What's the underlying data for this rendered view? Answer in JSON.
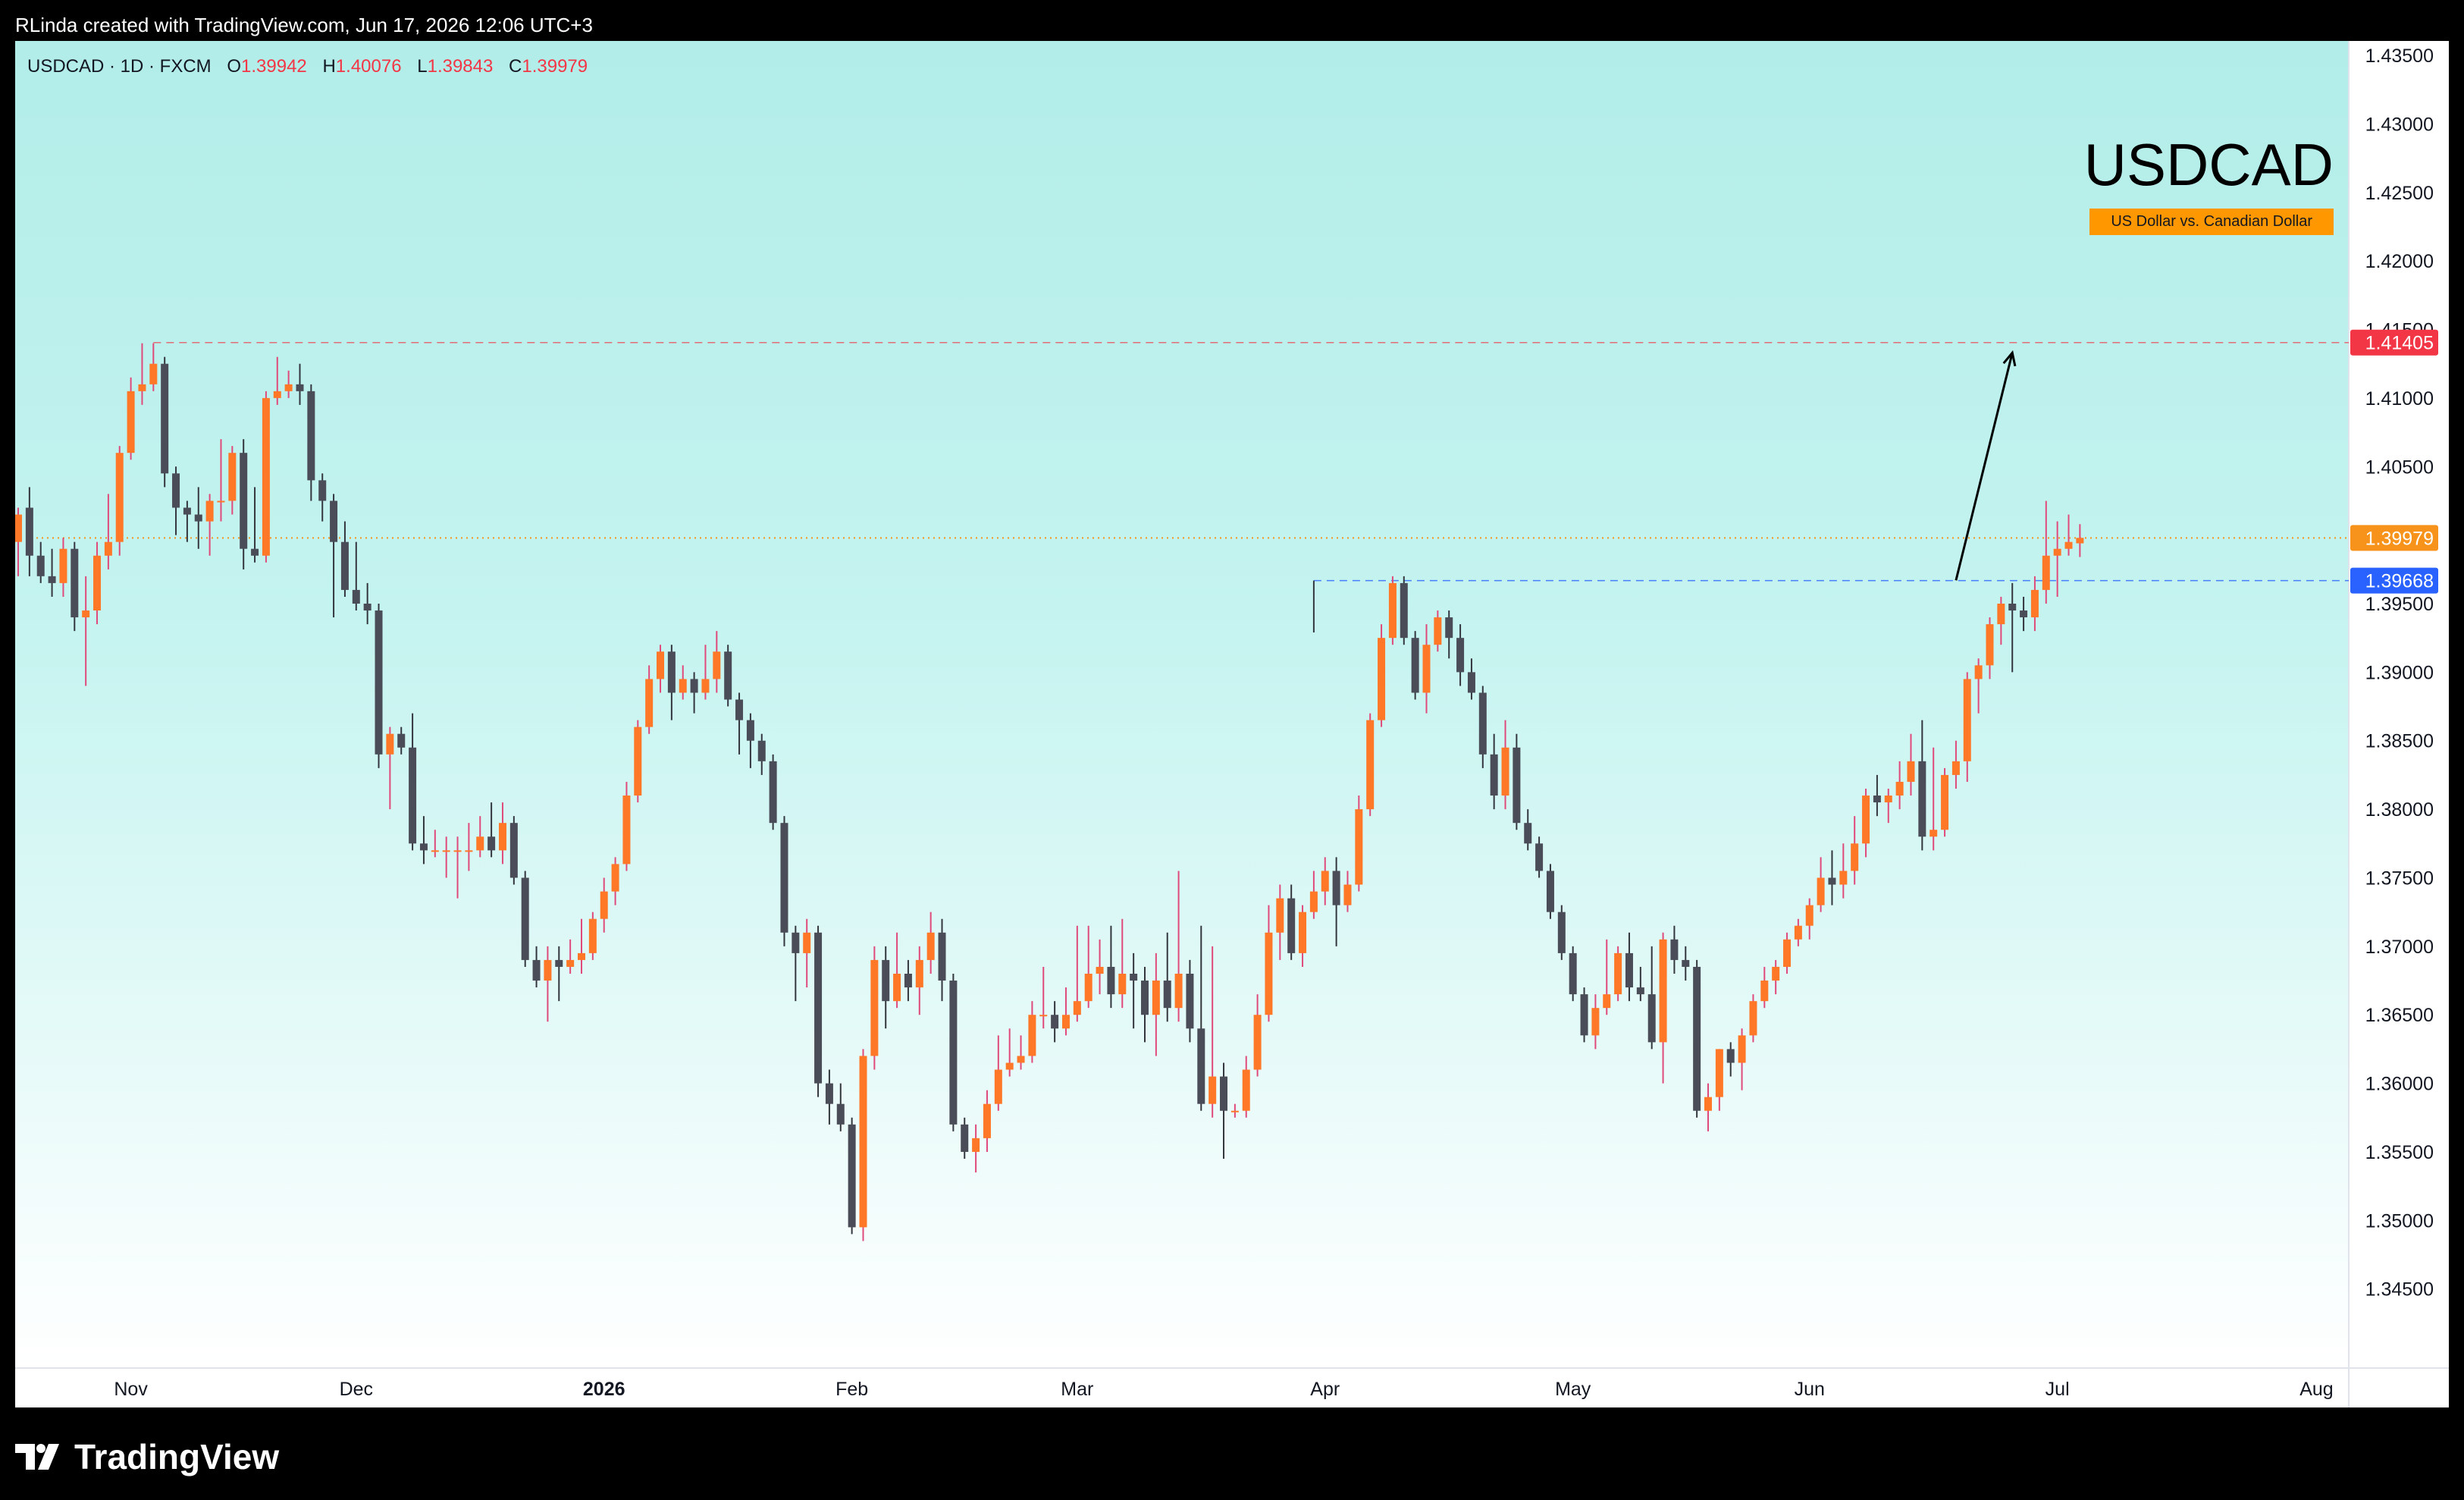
{
  "header": {
    "credit": "RLinda created with TradingView.com, Jun 17, 2026 12:06 UTC+3"
  },
  "legend": {
    "symbol": "USDCAD · 1D · FXCM",
    "o_label": "O",
    "o_value": "1.39942",
    "h_label": "H",
    "h_value": "1.40076",
    "l_label": "L",
    "l_value": "1.39843",
    "c_label": "C",
    "c_value": "1.39979"
  },
  "watermark": {
    "symbol": "USDCAD",
    "description": "US Dollar vs. Canadian Dollar"
  },
  "footer": {
    "logo_text": "TradingView",
    "logo_icon": "tradingview-logo-icon"
  },
  "colors": {
    "bull": "#ff7828",
    "bear": "#4a4d57",
    "bull_wick": "#e04a7a",
    "bear_wick": "#34363e",
    "high_line": "#f23645",
    "last_line": "#f7931a",
    "support_line": "#2962ff",
    "plot_top": "#b2ede9",
    "plot_bottom": "#ffffff"
  },
  "chart_data": {
    "type": "candlestick",
    "symbol": "USDCAD",
    "interval": "1D",
    "ylim": [
      1.341,
      1.4355
    ],
    "y_ticks": [
      "1.43500",
      "1.43000",
      "1.42500",
      "1.42000",
      "1.41500",
      "1.41000",
      "1.40500",
      "1.40000",
      "1.39500",
      "1.39000",
      "1.38500",
      "1.38000",
      "1.37500",
      "1.37000",
      "1.36500",
      "1.36000",
      "1.35500",
      "1.35000",
      "1.34500"
    ],
    "x_labels": [
      {
        "label": "Nov",
        "bar": 10,
        "bold": false
      },
      {
        "label": "Dec",
        "bar": 30,
        "bold": false
      },
      {
        "label": "2026",
        "bar": 52,
        "bold": true
      },
      {
        "label": "Feb",
        "bar": 74,
        "bold": false
      },
      {
        "label": "Mar",
        "bar": 94,
        "bold": false
      },
      {
        "label": "Apr",
        "bar": 116,
        "bold": false
      },
      {
        "label": "May",
        "bar": 138,
        "bold": false
      },
      {
        "label": "Jun",
        "bar": 159,
        "bold": false
      },
      {
        "label": "Jul",
        "bar": 181,
        "bold": false
      },
      {
        "label": "Aug",
        "bar": 204,
        "bold": false
      }
    ],
    "price_levels": [
      {
        "name": "high",
        "value": 1.41405,
        "label": "1.41405",
        "style": "dashed"
      },
      {
        "name": "last",
        "value": 1.39979,
        "label": "1.39979",
        "style": "dotted"
      },
      {
        "name": "support",
        "value": 1.39668,
        "label": "1.39668",
        "style": "dashed"
      }
    ],
    "projection_arrow": {
      "from": [
        172,
        1.3967
      ],
      "to": [
        177,
        1.4133
      ]
    },
    "candles": [
      [
        1.3995,
        1.4015,
        1.397,
        1.402
      ],
      [
        1.402,
        1.3985,
        1.397,
        1.4035
      ],
      [
        1.3985,
        1.397,
        1.3965,
        1.3995
      ],
      [
        1.397,
        1.3965,
        1.3955,
        1.399
      ],
      [
        1.3965,
        1.399,
        1.3955,
        1.3998
      ],
      [
        1.399,
        1.394,
        1.393,
        1.3995
      ],
      [
        1.394,
        1.3945,
        1.389,
        1.397
      ],
      [
        1.3945,
        1.3985,
        1.3935,
        1.3995
      ],
      [
        1.3985,
        1.3995,
        1.3975,
        1.403
      ],
      [
        1.3995,
        1.406,
        1.3985,
        1.4065
      ],
      [
        1.406,
        1.4105,
        1.4055,
        1.4115
      ],
      [
        1.4105,
        1.411,
        1.4095,
        1.414
      ],
      [
        1.411,
        1.4125,
        1.4105,
        1.414
      ],
      [
        1.4125,
        1.4045,
        1.4035,
        1.413
      ],
      [
        1.4045,
        1.402,
        1.4,
        1.405
      ],
      [
        1.402,
        1.4015,
        1.3995,
        1.4025
      ],
      [
        1.4015,
        1.401,
        1.399,
        1.4035
      ],
      [
        1.401,
        1.4025,
        1.3985,
        1.403
      ],
      [
        1.4025,
        1.4025,
        1.401,
        1.407
      ],
      [
        1.4025,
        1.406,
        1.4015,
        1.4065
      ],
      [
        1.406,
        1.399,
        1.3975,
        1.407
      ],
      [
        1.399,
        1.3985,
        1.398,
        1.4035
      ],
      [
        1.3985,
        1.41,
        1.398,
        1.4105
      ],
      [
        1.41,
        1.4105,
        1.4095,
        1.413
      ],
      [
        1.4105,
        1.411,
        1.41,
        1.412
      ],
      [
        1.411,
        1.4105,
        1.4095,
        1.4125
      ],
      [
        1.4105,
        1.404,
        1.4025,
        1.411
      ],
      [
        1.404,
        1.4025,
        1.401,
        1.4045
      ],
      [
        1.4025,
        1.3995,
        1.394,
        1.403
      ],
      [
        1.3995,
        1.396,
        1.3955,
        1.401
      ],
      [
        1.396,
        1.395,
        1.3945,
        1.3995
      ],
      [
        1.395,
        1.3945,
        1.3935,
        1.3965
      ],
      [
        1.3945,
        1.384,
        1.383,
        1.395
      ],
      [
        1.384,
        1.3855,
        1.38,
        1.386
      ],
      [
        1.3855,
        1.3845,
        1.384,
        1.386
      ],
      [
        1.3845,
        1.3775,
        1.377,
        1.387
      ],
      [
        1.3775,
        1.377,
        1.376,
        1.3795
      ],
      [
        1.377,
        1.377,
        1.3765,
        1.3785
      ],
      [
        1.377,
        1.377,
        1.375,
        1.378
      ],
      [
        1.377,
        1.377,
        1.3735,
        1.378
      ],
      [
        1.377,
        1.377,
        1.3755,
        1.379
      ],
      [
        1.377,
        1.378,
        1.3765,
        1.3795
      ],
      [
        1.378,
        1.377,
        1.3765,
        1.3805
      ],
      [
        1.377,
        1.379,
        1.376,
        1.3805
      ],
      [
        1.379,
        1.375,
        1.3745,
        1.3795
      ],
      [
        1.375,
        1.369,
        1.3685,
        1.3755
      ],
      [
        1.369,
        1.3675,
        1.367,
        1.37
      ],
      [
        1.3675,
        1.369,
        1.3645,
        1.37
      ],
      [
        1.369,
        1.3685,
        1.366,
        1.37
      ],
      [
        1.3685,
        1.369,
        1.368,
        1.3705
      ],
      [
        1.369,
        1.3695,
        1.368,
        1.372
      ],
      [
        1.3695,
        1.372,
        1.369,
        1.3725
      ],
      [
        1.372,
        1.374,
        1.371,
        1.375
      ],
      [
        1.374,
        1.376,
        1.373,
        1.3765
      ],
      [
        1.376,
        1.381,
        1.3755,
        1.382
      ],
      [
        1.381,
        1.386,
        1.3805,
        1.3865
      ],
      [
        1.386,
        1.3895,
        1.3855,
        1.3905
      ],
      [
        1.3895,
        1.3915,
        1.3885,
        1.392
      ],
      [
        1.3915,
        1.3885,
        1.3865,
        1.392
      ],
      [
        1.3885,
        1.3895,
        1.388,
        1.3905
      ],
      [
        1.3895,
        1.3885,
        1.387,
        1.39
      ],
      [
        1.3885,
        1.3895,
        1.388,
        1.392
      ],
      [
        1.3895,
        1.3915,
        1.3885,
        1.393
      ],
      [
        1.3915,
        1.388,
        1.3875,
        1.392
      ],
      [
        1.388,
        1.3865,
        1.384,
        1.3885
      ],
      [
        1.3865,
        1.385,
        1.383,
        1.387
      ],
      [
        1.385,
        1.3835,
        1.3825,
        1.3855
      ],
      [
        1.3835,
        1.379,
        1.3785,
        1.384
      ],
      [
        1.379,
        1.371,
        1.37,
        1.3795
      ],
      [
        1.371,
        1.3695,
        1.366,
        1.3715
      ],
      [
        1.3695,
        1.371,
        1.367,
        1.372
      ],
      [
        1.371,
        1.36,
        1.359,
        1.3715
      ],
      [
        1.36,
        1.3585,
        1.357,
        1.361
      ],
      [
        1.3585,
        1.357,
        1.3565,
        1.36
      ],
      [
        1.357,
        1.3495,
        1.349,
        1.3575
      ],
      [
        1.3495,
        1.362,
        1.3485,
        1.3625
      ],
      [
        1.362,
        1.369,
        1.361,
        1.37
      ],
      [
        1.369,
        1.366,
        1.364,
        1.37
      ],
      [
        1.366,
        1.368,
        1.3655,
        1.371
      ],
      [
        1.368,
        1.367,
        1.366,
        1.369
      ],
      [
        1.367,
        1.369,
        1.365,
        1.37
      ],
      [
        1.369,
        1.371,
        1.368,
        1.3725
      ],
      [
        1.371,
        1.3675,
        1.366,
        1.372
      ],
      [
        1.3675,
        1.357,
        1.3565,
        1.368
      ],
      [
        1.357,
        1.355,
        1.3545,
        1.3575
      ],
      [
        1.355,
        1.356,
        1.3535,
        1.357
      ],
      [
        1.356,
        1.3585,
        1.355,
        1.3595
      ],
      [
        1.3585,
        1.361,
        1.358,
        1.3635
      ],
      [
        1.361,
        1.3615,
        1.3605,
        1.364
      ],
      [
        1.3615,
        1.362,
        1.361,
        1.3635
      ],
      [
        1.362,
        1.365,
        1.3615,
        1.366
      ],
      [
        1.365,
        1.365,
        1.364,
        1.3685
      ],
      [
        1.365,
        1.364,
        1.363,
        1.366
      ],
      [
        1.364,
        1.365,
        1.3635,
        1.367
      ],
      [
        1.365,
        1.366,
        1.3645,
        1.3715
      ],
      [
        1.366,
        1.368,
        1.3655,
        1.3715
      ],
      [
        1.368,
        1.3685,
        1.3665,
        1.3705
      ],
      [
        1.3685,
        1.3665,
        1.3655,
        1.3715
      ],
      [
        1.3665,
        1.368,
        1.3655,
        1.372
      ],
      [
        1.368,
        1.3675,
        1.364,
        1.3695
      ],
      [
        1.3675,
        1.365,
        1.363,
        1.3685
      ],
      [
        1.365,
        1.3675,
        1.362,
        1.3695
      ],
      [
        1.3675,
        1.3655,
        1.3645,
        1.371
      ],
      [
        1.3655,
        1.368,
        1.3645,
        1.3755
      ],
      [
        1.368,
        1.364,
        1.363,
        1.369
      ],
      [
        1.364,
        1.3585,
        1.358,
        1.3715
      ],
      [
        1.3585,
        1.3605,
        1.3575,
        1.37
      ],
      [
        1.3605,
        1.358,
        1.3545,
        1.3615
      ],
      [
        1.358,
        1.358,
        1.3575,
        1.3585
      ],
      [
        1.358,
        1.361,
        1.3575,
        1.362
      ],
      [
        1.361,
        1.365,
        1.3605,
        1.3665
      ],
      [
        1.365,
        1.371,
        1.3645,
        1.373
      ],
      [
        1.371,
        1.3735,
        1.369,
        1.3745
      ],
      [
        1.3735,
        1.3695,
        1.369,
        1.3745
      ],
      [
        1.3695,
        1.3725,
        1.3685,
        1.373
      ],
      [
        1.3725,
        1.374,
        1.372,
        1.3755
      ],
      [
        1.374,
        1.3755,
        1.373,
        1.3765
      ],
      [
        1.3755,
        1.373,
        1.37,
        1.3765
      ],
      [
        1.373,
        1.3745,
        1.3725,
        1.3755
      ],
      [
        1.3745,
        1.38,
        1.374,
        1.381
      ],
      [
        1.38,
        1.3865,
        1.3795,
        1.387
      ],
      [
        1.3865,
        1.3925,
        1.386,
        1.3935
      ],
      [
        1.3925,
        1.3965,
        1.392,
        1.397
      ],
      [
        1.3965,
        1.3925,
        1.392,
        1.397
      ],
      [
        1.3925,
        1.3885,
        1.388,
        1.393
      ],
      [
        1.3885,
        1.392,
        1.387,
        1.3935
      ],
      [
        1.392,
        1.394,
        1.3915,
        1.3945
      ],
      [
        1.394,
        1.3925,
        1.391,
        1.3945
      ],
      [
        1.3925,
        1.39,
        1.389,
        1.3935
      ],
      [
        1.39,
        1.3885,
        1.388,
        1.391
      ],
      [
        1.3885,
        1.384,
        1.383,
        1.389
      ],
      [
        1.384,
        1.381,
        1.38,
        1.3855
      ],
      [
        1.381,
        1.3845,
        1.38,
        1.3865
      ],
      [
        1.3845,
        1.379,
        1.3785,
        1.3855
      ],
      [
        1.379,
        1.3775,
        1.377,
        1.38
      ],
      [
        1.3775,
        1.3755,
        1.375,
        1.378
      ],
      [
        1.3755,
        1.3725,
        1.372,
        1.376
      ],
      [
        1.3725,
        1.3695,
        1.369,
        1.373
      ],
      [
        1.3695,
        1.3665,
        1.366,
        1.37
      ],
      [
        1.3665,
        1.3635,
        1.363,
        1.367
      ],
      [
        1.3635,
        1.3655,
        1.3625,
        1.3665
      ],
      [
        1.3655,
        1.3665,
        1.365,
        1.3705
      ],
      [
        1.3665,
        1.3695,
        1.366,
        1.37
      ],
      [
        1.3695,
        1.367,
        1.366,
        1.371
      ],
      [
        1.367,
        1.3665,
        1.366,
        1.3685
      ],
      [
        1.3665,
        1.363,
        1.3625,
        1.37
      ],
      [
        1.363,
        1.3705,
        1.36,
        1.371
      ],
      [
        1.3705,
        1.369,
        1.368,
        1.3715
      ],
      [
        1.369,
        1.3685,
        1.3675,
        1.37
      ],
      [
        1.3685,
        1.358,
        1.3575,
        1.369
      ],
      [
        1.358,
        1.359,
        1.3565,
        1.36
      ],
      [
        1.359,
        1.3625,
        1.358,
        1.3625
      ],
      [
        1.3625,
        1.3615,
        1.3605,
        1.363
      ],
      [
        1.3615,
        1.3635,
        1.3595,
        1.364
      ],
      [
        1.3635,
        1.366,
        1.363,
        1.3665
      ],
      [
        1.366,
        1.3675,
        1.3655,
        1.3685
      ],
      [
        1.3675,
        1.3685,
        1.3665,
        1.369
      ],
      [
        1.3685,
        1.3705,
        1.368,
        1.371
      ],
      [
        1.3705,
        1.3715,
        1.37,
        1.372
      ],
      [
        1.3715,
        1.373,
        1.3705,
        1.3735
      ],
      [
        1.373,
        1.375,
        1.3725,
        1.3765
      ],
      [
        1.375,
        1.3745,
        1.373,
        1.377
      ],
      [
        1.3745,
        1.3755,
        1.3735,
        1.3775
      ],
      [
        1.3755,
        1.3775,
        1.3745,
        1.3795
      ],
      [
        1.3775,
        1.381,
        1.3765,
        1.3815
      ],
      [
        1.381,
        1.3805,
        1.3795,
        1.3825
      ],
      [
        1.3805,
        1.381,
        1.379,
        1.3815
      ],
      [
        1.381,
        1.382,
        1.38,
        1.3835
      ],
      [
        1.382,
        1.3835,
        1.381,
        1.3855
      ],
      [
        1.3835,
        1.378,
        1.377,
        1.3865
      ],
      [
        1.378,
        1.3785,
        1.377,
        1.3845
      ],
      [
        1.3785,
        1.3825,
        1.378,
        1.383
      ],
      [
        1.3825,
        1.3835,
        1.3815,
        1.385
      ],
      [
        1.3835,
        1.3895,
        1.382,
        1.39
      ],
      [
        1.3895,
        1.3905,
        1.387,
        1.391
      ],
      [
        1.3905,
        1.3935,
        1.3895,
        1.394
      ],
      [
        1.3935,
        1.395,
        1.392,
        1.3955
      ],
      [
        1.395,
        1.3945,
        1.39,
        1.3965
      ],
      [
        1.3945,
        1.394,
        1.393,
        1.3955
      ],
      [
        1.394,
        1.396,
        1.393,
        1.397
      ],
      [
        1.396,
        1.3985,
        1.395,
        1.4025
      ],
      [
        1.3985,
        1.399,
        1.3955,
        1.401
      ],
      [
        1.399,
        1.3995,
        1.3985,
        1.4015
      ],
      [
        1.3994,
        1.3998,
        1.3984,
        1.4008
      ]
    ]
  }
}
